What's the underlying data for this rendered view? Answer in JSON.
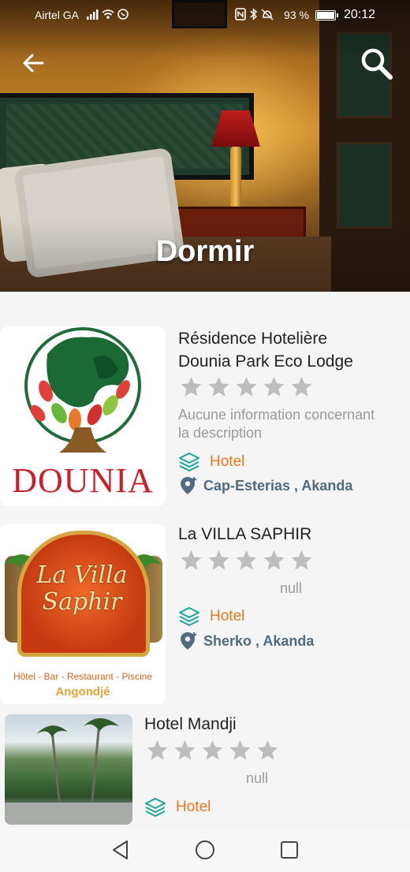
{
  "status_bar": {
    "carrier": "Airtel GA",
    "battery": "93 %",
    "time": "20:12"
  },
  "header": {
    "title": "Dormir"
  },
  "hotels": [
    {
      "name_line1": "Résidence Hotelière",
      "name_line2": "Dounia Park Eco Lodge",
      "rating": 0,
      "description_line1": "Aucune information concernant",
      "description_line2": "la description",
      "category": "Hotel",
      "location": "Cap-Esterias , Akanda",
      "logo_text": "DOUNIA"
    },
    {
      "name": "La VILLA SAPHIR",
      "rating": 0,
      "description": "null",
      "category": "Hotel",
      "location": "Sherko , Akanda",
      "logo_script": "La Villa Saphir",
      "logo_tagline": "Hôtel - Bar - Restaurant - Piscine",
      "logo_place": "Angondjé"
    },
    {
      "name": "Hotel Mandji",
      "rating": 0,
      "description": "null",
      "category": "Hotel"
    }
  ],
  "colors": {
    "star_empty": "#bdbdbd",
    "category_icon": "#1aa49a",
    "category_text": "#e07a1c",
    "location": "#4e6b80"
  },
  "icons": {
    "back": "arrow-left-icon",
    "search": "search-icon",
    "category": "layers-icon",
    "location": "location-pin-icon"
  }
}
